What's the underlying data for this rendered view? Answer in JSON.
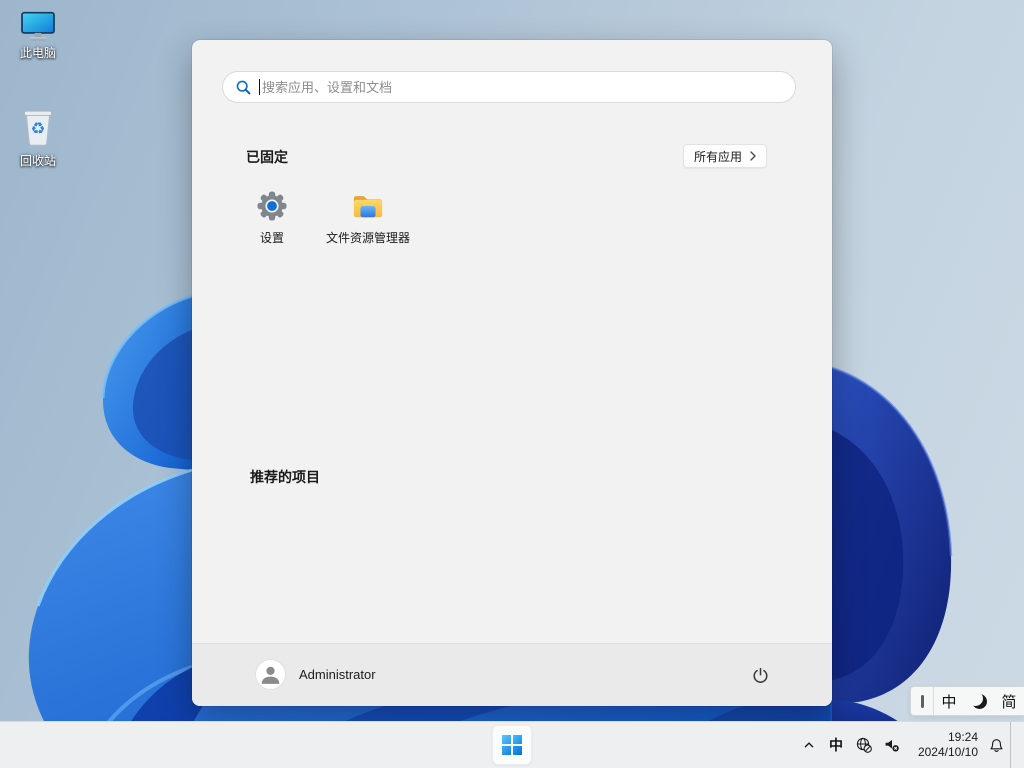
{
  "desktop": {
    "icons": [
      {
        "label": "此电脑",
        "icon": "computer-monitor"
      },
      {
        "label": "回收站",
        "icon": "recycle-bin"
      }
    ]
  },
  "start_menu": {
    "search": {
      "placeholder": "搜索应用、设置和文档",
      "icon": "search-magnifier"
    },
    "pinned": {
      "title": "已固定",
      "all_apps_label": "所有应用",
      "apps": [
        {
          "label": "设置",
          "icon": "settings-gear"
        },
        {
          "label": "文件资源管理器",
          "icon": "yellow-folder"
        }
      ]
    },
    "recommended": {
      "title": "推荐的项目"
    },
    "footer": {
      "user_name": "Administrator",
      "avatar_icon": "person-silhouette",
      "power_icon": "power-symbol"
    }
  },
  "taskbar": {
    "start_icon": "windows-four-squares",
    "tray": {
      "hidden_icons": "chevron-up",
      "ime_indicator": "中",
      "network_icon": "globe-no-internet",
      "volume_icon": "speaker-muted",
      "time": "19:24",
      "date": "2024/10/10",
      "notifications_icon": "bell"
    }
  },
  "ime_bar": {
    "handle": "drag-handle",
    "mode": "中",
    "shape_icon": "crescent-moon",
    "charset": "简"
  },
  "colors": {
    "accent_blue": "#0a6dd3",
    "menu_bg": "#f2f2f2",
    "taskbar_bg": "#edeff0",
    "wallpaper_base": "#b6c9da",
    "bloom_bright_blue": "#2b79e0",
    "bloom_dark_blue": "#12309a"
  }
}
